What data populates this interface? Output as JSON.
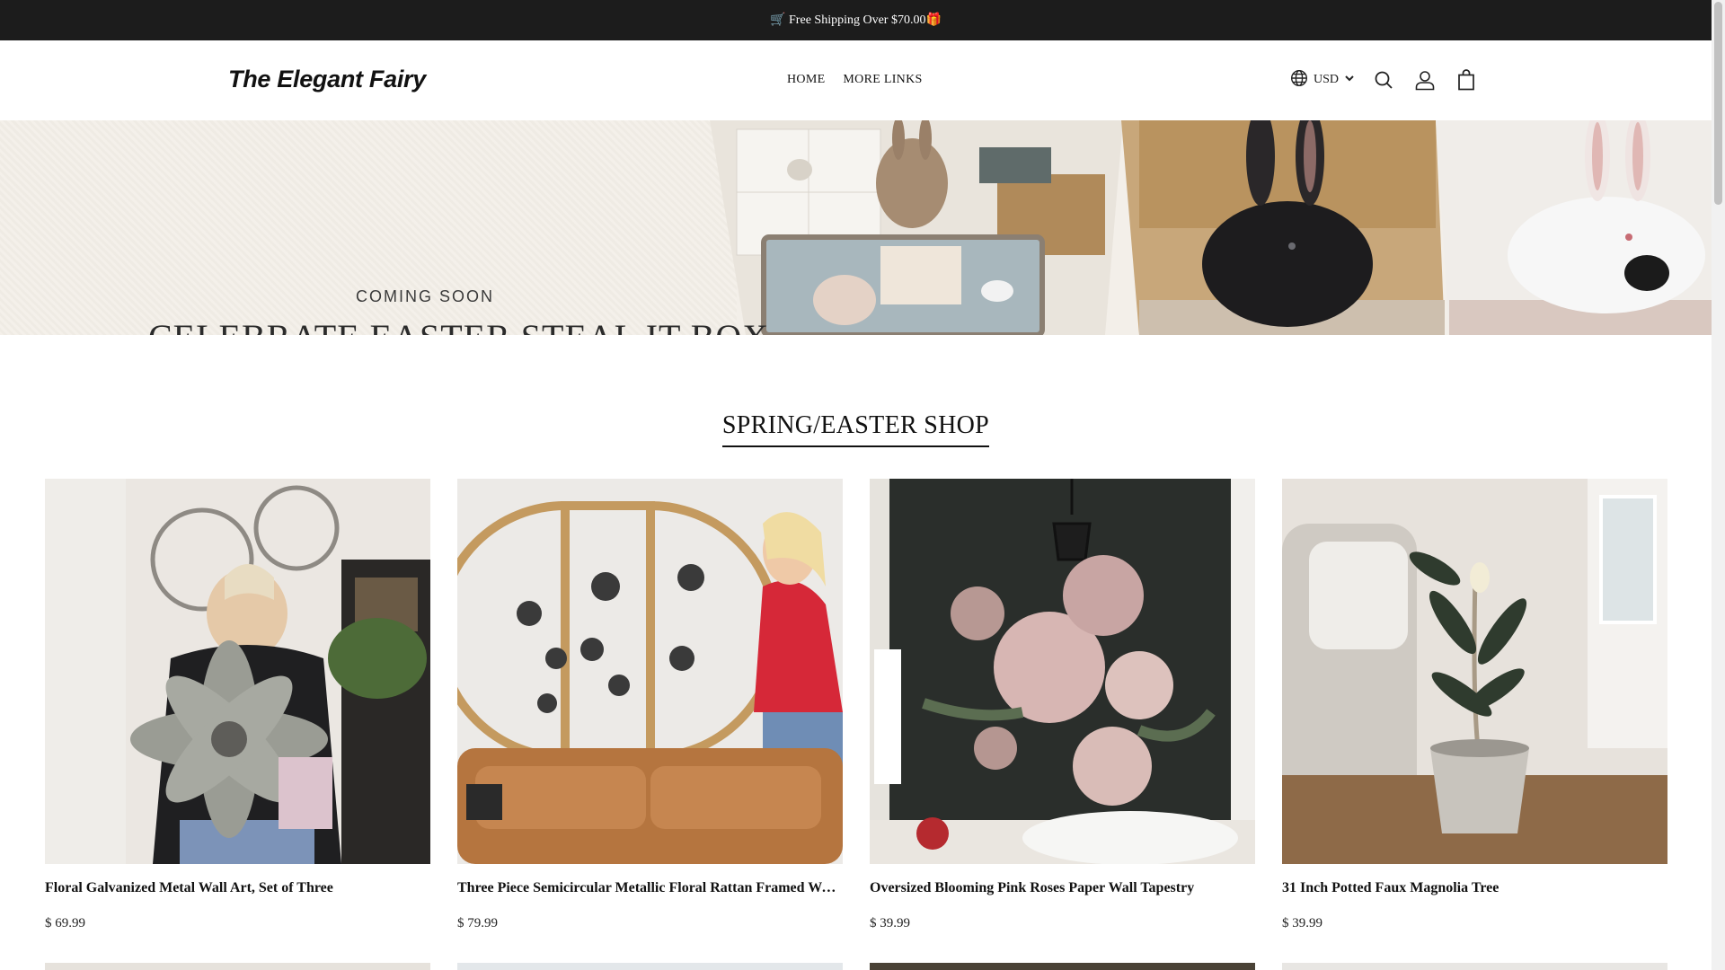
{
  "announcement": {
    "text": "🛒 Free Shipping Over $70.00🎁"
  },
  "header": {
    "logo": "The Elegant Fairy",
    "nav": [
      "HOME",
      "MORE LINKS"
    ],
    "currency": "USD",
    "icons": [
      "globe-icon",
      "chevron-down-icon",
      "search-icon",
      "account-icon",
      "bag-icon"
    ]
  },
  "hero": {
    "coming": "COMING SOON",
    "headline": "CELEBRATE EASTER STEAL IT BOX"
  },
  "section": {
    "title": "SPRING/EASTER SHOP"
  },
  "products": [
    {
      "title": "Floral Galvanized Metal Wall Art, Set of Three",
      "price": "$ 69.99"
    },
    {
      "title": "Three Piece Semicircular Metallic Floral Rattan Framed Wall Art",
      "price": "$ 79.99"
    },
    {
      "title": "Oversized Blooming Pink Roses Paper Wall Tapestry",
      "price": "$ 39.99"
    },
    {
      "title": "31 Inch Potted Faux Magnolia Tree",
      "price": "$ 39.99"
    }
  ],
  "colors": {
    "topbar": "#1c1c1c",
    "text": "#111111",
    "background": "#ffffff"
  }
}
